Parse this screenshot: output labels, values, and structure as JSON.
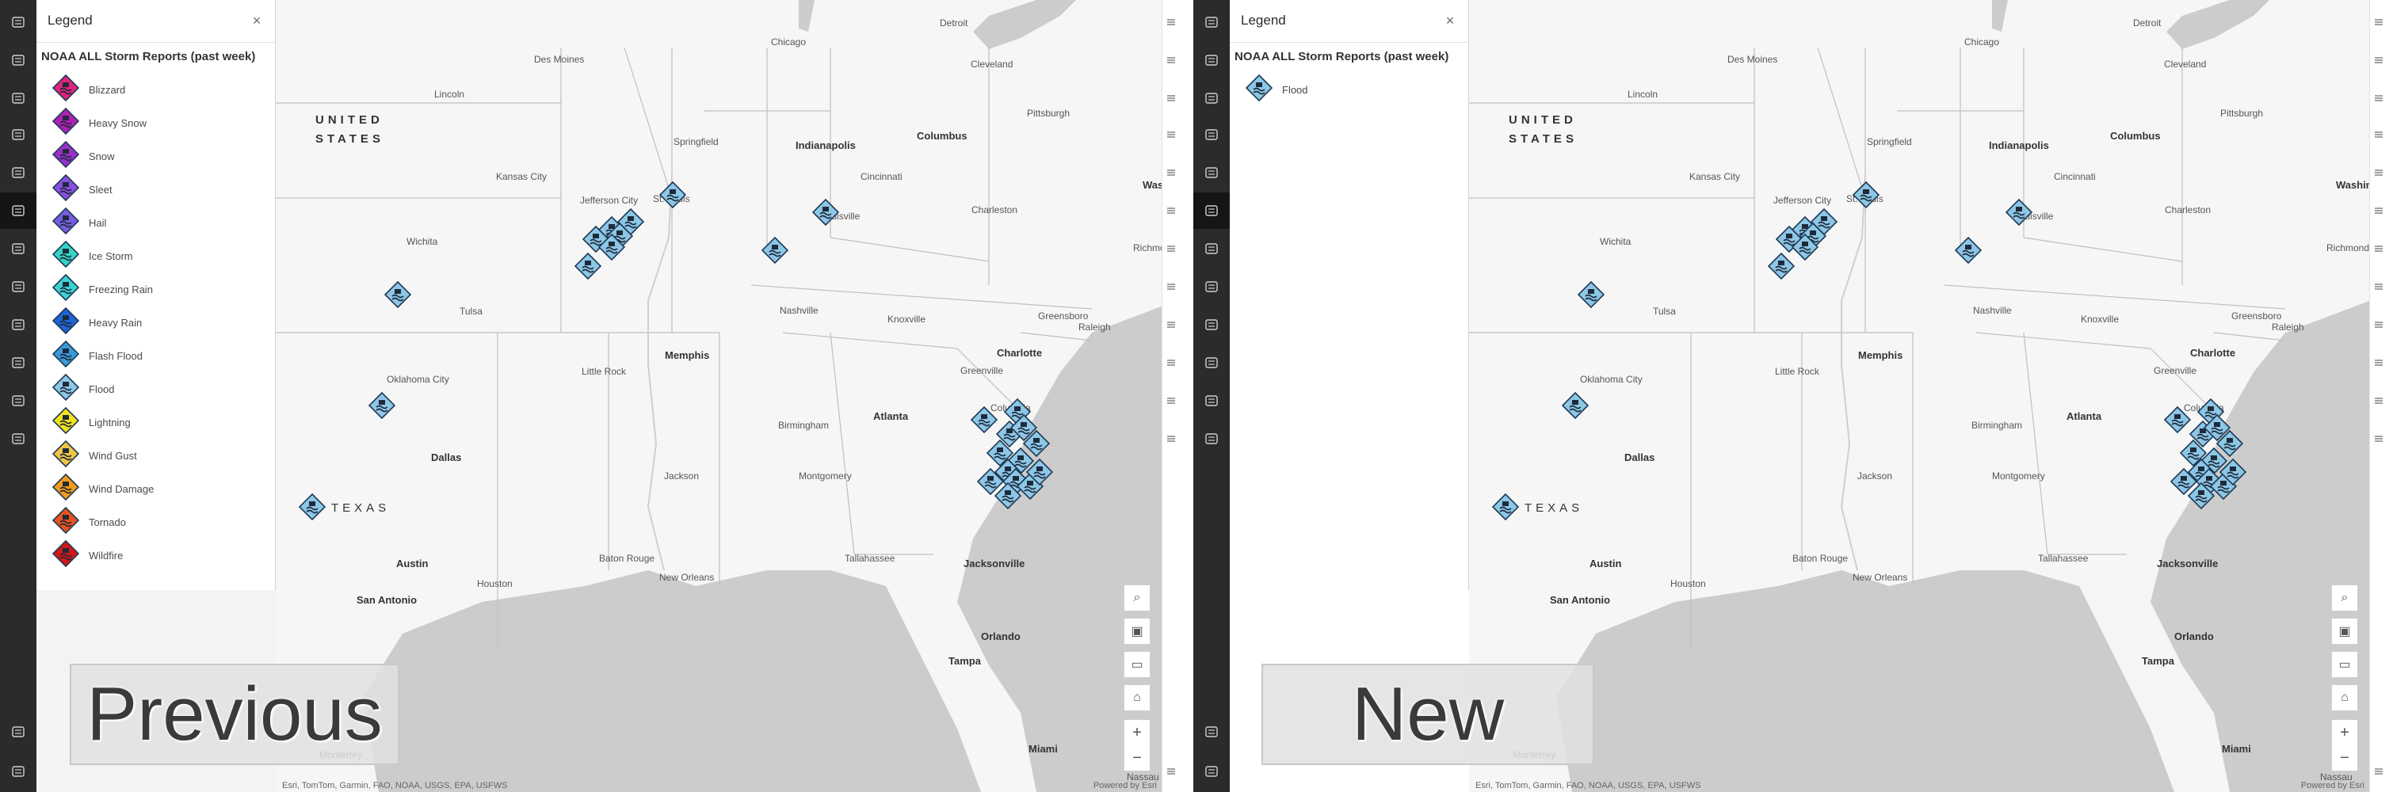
{
  "panels": {
    "previous": {
      "watermark": "Previous"
    },
    "new": {
      "watermark": "New"
    }
  },
  "legend": {
    "title": "Legend",
    "close_icon": "×",
    "layer_title": "NOAA ALL Storm Reports (past week)",
    "previous_items": [
      {
        "label": "Blizzard",
        "color": "#e2237e",
        "icon": "blizzard-icon"
      },
      {
        "label": "Heavy Snow",
        "color": "#b21fb6",
        "icon": "heavy-snow-icon"
      },
      {
        "label": "Snow",
        "color": "#9b2fc9",
        "icon": "snow-icon"
      },
      {
        "label": "Sleet",
        "color": "#8a4fe0",
        "icon": "sleet-icon"
      },
      {
        "label": "Hail",
        "color": "#7a5ce0",
        "icon": "hail-icon"
      },
      {
        "label": "Ice Storm",
        "color": "#36d4c4",
        "icon": "ice-storm-icon"
      },
      {
        "label": "Freezing Rain",
        "color": "#3bd2d2",
        "icon": "freezing-rain-icon"
      },
      {
        "label": "Heavy Rain",
        "color": "#1f63d8",
        "icon": "heavy-rain-icon"
      },
      {
        "label": "Flash Flood",
        "color": "#3a9ad9",
        "icon": "flash-flood-icon"
      },
      {
        "label": "Flood",
        "color": "#8ec6e6",
        "icon": "flood-icon"
      },
      {
        "label": "Lightning",
        "color": "#f2e21a",
        "icon": "lightning-icon"
      },
      {
        "label": "Wind Gust",
        "color": "#f2c542",
        "icon": "wind-gust-icon"
      },
      {
        "label": "Wind Damage",
        "color": "#f29a1a",
        "icon": "wind-damage-icon"
      },
      {
        "label": "Tornado",
        "color": "#e8521c",
        "icon": "tornado-icon"
      },
      {
        "label": "Wildfire",
        "color": "#d41818",
        "icon": "wildfire-icon"
      }
    ],
    "new_items": [
      {
        "label": "Flood",
        "color": "#8ec6e6",
        "icon": "flood-icon"
      }
    ]
  },
  "map": {
    "country_label_line1": "UNITED",
    "country_label_line2": "STATES",
    "texas_label": "TEXAS",
    "cities": [
      {
        "name": "Chicago",
        "major": false
      },
      {
        "name": "Detroit",
        "major": false
      },
      {
        "name": "Cleveland",
        "major": false
      },
      {
        "name": "Des Moines",
        "major": false
      },
      {
        "name": "Lincoln",
        "major": false
      },
      {
        "name": "Pittsburgh",
        "major": false
      },
      {
        "name": "Springfield",
        "major": false
      },
      {
        "name": "Indianapolis",
        "major": true
      },
      {
        "name": "Columbus",
        "major": true
      },
      {
        "name": "Kansas City",
        "major": false
      },
      {
        "name": "Jefferson City",
        "major": false
      },
      {
        "name": "St. Louis",
        "major": false
      },
      {
        "name": "Cincinnati",
        "major": false
      },
      {
        "name": "Washin",
        "major": true
      },
      {
        "name": "Louisville",
        "major": false
      },
      {
        "name": "Charleston",
        "major": false
      },
      {
        "name": "Wichita",
        "major": false
      },
      {
        "name": "Richmond",
        "major": false
      },
      {
        "name": "Tulsa",
        "major": false
      },
      {
        "name": "Nashville",
        "major": false
      },
      {
        "name": "Knoxville",
        "major": false
      },
      {
        "name": "Greensboro",
        "major": false
      },
      {
        "name": "Raleigh",
        "major": false
      },
      {
        "name": "Oklahoma City",
        "major": false
      },
      {
        "name": "Charlotte",
        "major": true
      },
      {
        "name": "Little Rock",
        "major": false
      },
      {
        "name": "Memphis",
        "major": true
      },
      {
        "name": "Greenville",
        "major": false
      },
      {
        "name": "Columbia",
        "major": false
      },
      {
        "name": "Atlanta",
        "major": true
      },
      {
        "name": "Birmingham",
        "major": false
      },
      {
        "name": "Dallas",
        "major": true
      },
      {
        "name": "Jackson",
        "major": false
      },
      {
        "name": "Montgomery",
        "major": false
      },
      {
        "name": "Austin",
        "major": true
      },
      {
        "name": "Houston",
        "major": false
      },
      {
        "name": "Baton Rouge",
        "major": false
      },
      {
        "name": "New Orleans",
        "major": false
      },
      {
        "name": "Tallahassee",
        "major": false
      },
      {
        "name": "Jacksonville",
        "major": true
      },
      {
        "name": "San Antonio",
        "major": true
      },
      {
        "name": "Orlando",
        "major": true
      },
      {
        "name": "Tampa",
        "major": true
      },
      {
        "name": "Miami",
        "major": true
      },
      {
        "name": "Monterrey",
        "major": false
      },
      {
        "name": "Nassau",
        "major": false
      }
    ],
    "attribution": "Esri, TomTom, Garmin, FAO, NOAA, USGS, EPA, USFWS",
    "powered_by": "Powered by Esri",
    "zoom_in": "+",
    "zoom_out": "−"
  },
  "left_rail_icons": [
    "add-icon",
    "layers-icon",
    "table-icon",
    "grid-icon",
    "chart-icon",
    "legend-list-icon",
    "bookmark-icon",
    "card-icon",
    "settings-icon",
    "export-icon",
    "apps-icon",
    "print-icon",
    "info-icon",
    "expand-icon"
  ],
  "right_rail_icons": [
    "properties-icon",
    "styles-icon",
    "filter-icon",
    "effects-icon",
    "pop-ups-icon",
    "fields-icon",
    "labels-icon",
    "sketch-icon",
    "layer-analysis-icon",
    "arcade-icon",
    "edit-icon",
    "measure-icon",
    "collapse-icon"
  ]
}
